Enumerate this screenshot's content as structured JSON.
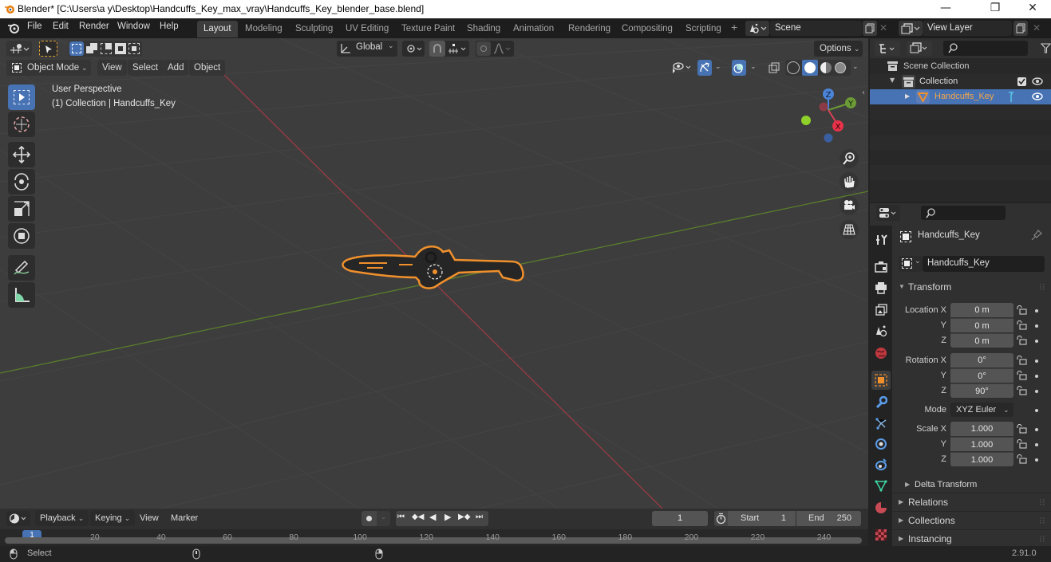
{
  "window": {
    "title": "Blender* [C:\\Users\\a y\\Desktop\\Handcuffs_Key_max_vray\\Handcuffs_Key_blender_base.blend]",
    "minimize": "—",
    "maximize": "❐",
    "close": "✕"
  },
  "topbar": {
    "menus": [
      "File",
      "Edit",
      "Render",
      "Window",
      "Help"
    ],
    "workspaces": [
      "Layout",
      "Modeling",
      "Sculpting",
      "UV Editing",
      "Texture Paint",
      "Shading",
      "Animation",
      "Rendering",
      "Compositing",
      "Scripting"
    ],
    "active_workspace": "Layout",
    "add_workspace": "+",
    "scene": "Scene",
    "view_layer": "View Layer"
  },
  "viewport": {
    "mode": "Object Mode",
    "header_menus": [
      "View",
      "Select",
      "Add",
      "Object"
    ],
    "transform_orientation": "Global",
    "options_label": "Options",
    "overlay_line1": "User Perspective",
    "overlay_line2": "(1) Collection | Handcuffs_Key",
    "gizmo": {
      "x": "X",
      "y": "Y",
      "z": "Z"
    },
    "colors": {
      "x_axis": "#c44a55",
      "y_axis": "#6c9a36",
      "selection": "#f0902c",
      "active_tool": "#4772b3"
    }
  },
  "outliner": {
    "search_placeholder": "",
    "items": [
      {
        "label": "Scene Collection",
        "level": 0
      },
      {
        "label": "Collection",
        "level": 1,
        "expanded": true,
        "checked": true
      },
      {
        "label": "Handcuffs_Key",
        "level": 2,
        "selected": true
      }
    ]
  },
  "properties": {
    "search_placeholder": "",
    "object_name_header": "Handcuffs_Key",
    "object_name_field": "Handcuffs_Key",
    "transform_label": "Transform",
    "location": {
      "label": "Location X",
      "x": "0 m",
      "y": "0 m",
      "z": "0 m"
    },
    "rotation": {
      "label": "Rotation X",
      "x": "0°",
      "y": "0°",
      "z": "90°"
    },
    "mode_label": "Mode",
    "mode_value": "XYZ Euler",
    "scale": {
      "label": "Scale X",
      "x": "1.000",
      "y": "1.000",
      "z": "1.000"
    },
    "axis_y": "Y",
    "axis_z": "Z",
    "subpanels": [
      "Delta Transform",
      "Relations",
      "Collections",
      "Instancing"
    ]
  },
  "timeline": {
    "menus": [
      "Playback",
      "Keying",
      "View",
      "Marker"
    ],
    "current_frame": "1",
    "start_label": "Start",
    "start_value": "1",
    "end_label": "End",
    "end_value": "250",
    "playhead": "1",
    "ticks": [
      "20",
      "40",
      "60",
      "80",
      "100",
      "120",
      "140",
      "160",
      "180",
      "200",
      "220",
      "240"
    ]
  },
  "statusbar": {
    "select_label": "Select",
    "version": "2.91.0"
  }
}
